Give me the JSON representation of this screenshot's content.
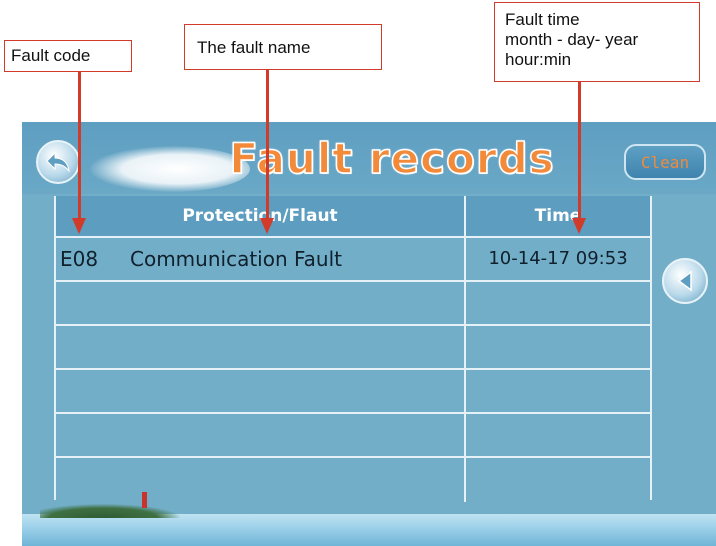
{
  "callouts": {
    "fault_code": "Fault code",
    "fault_name": "The fault name",
    "fault_time": [
      "Fault time",
      "month - day- year",
      "hour:min"
    ]
  },
  "screen": {
    "title": "Fault records",
    "back_icon": "back-arrow-icon",
    "clean_label": "Clean",
    "next_icon": "left-triangle-icon"
  },
  "table": {
    "headers": [
      "Protection/Flaut",
      "Time"
    ],
    "rows": [
      {
        "code": "E08",
        "name": "Communication Fault",
        "time": "10-14-17 09:53"
      },
      {
        "code": "",
        "name": "",
        "time": ""
      },
      {
        "code": "",
        "name": "",
        "time": ""
      },
      {
        "code": "",
        "name": "",
        "time": ""
      },
      {
        "code": "",
        "name": "",
        "time": ""
      },
      {
        "code": "",
        "name": "",
        "time": ""
      }
    ]
  },
  "colors": {
    "annotation": "#d23a2a",
    "screen_bg": "#72aec8",
    "title": "#f28a3a"
  }
}
